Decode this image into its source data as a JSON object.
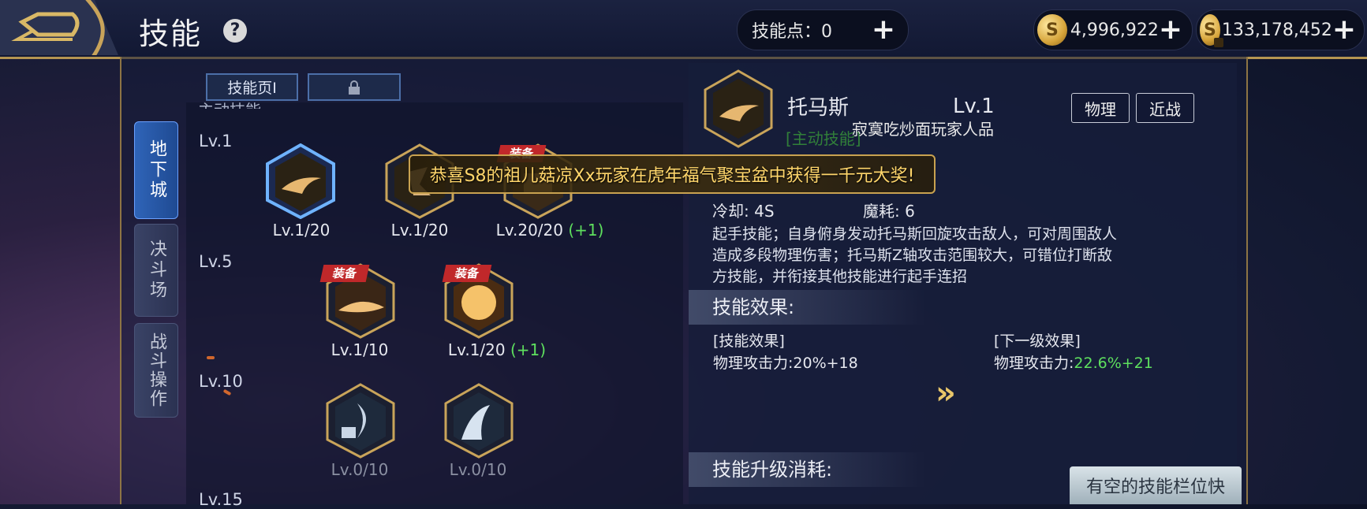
{
  "header": {
    "title": "技能",
    "skill_points_label": "技能点：0",
    "gold": "4,996,922",
    "bound_gold": "133,178,452"
  },
  "side_tabs": [
    "地下城",
    "决斗场",
    "战斗操作"
  ],
  "pages": {
    "page1": "技能页Ⅰ"
  },
  "section_title": "主动技能",
  "levels": [
    "Lv.1",
    "Lv.5",
    "Lv.10",
    "Lv.15"
  ],
  "equip_badge": "装备",
  "skills": [
    {
      "lv": "Lv.1/20",
      "bonus": ""
    },
    {
      "lv": "Lv.1/20",
      "bonus": ""
    },
    {
      "lv": "Lv.20/20",
      "bonus": "(+1)"
    },
    {
      "lv": "Lv.1/10",
      "bonus": ""
    },
    {
      "lv": "Lv.1/20",
      "bonus": "(+1)"
    },
    {
      "lv": "Lv.0/10",
      "bonus": ""
    },
    {
      "lv": "Lv.0/10",
      "bonus": ""
    }
  ],
  "detail": {
    "name": "托马斯",
    "level": "Lv.1",
    "tag_physical": "物理",
    "tag_melee": "近战",
    "type": "[主动技能]",
    "player_note": "寂寞吃炒面玩家人品",
    "cooldown": "冷却: 4S",
    "mp_cost": "魔耗: 6",
    "description": "起手技能；自身俯身发动托马斯回旋攻击敌人，可对周围敌人造成多段物理伤害；托马斯Z轴攻击范围较大，可错位打断敌方技能，并衔接其他技能进行起手连招",
    "effect_heading": "技能效果:",
    "current_label": "[技能效果]",
    "current_value": "物理攻击力:20%+18",
    "next_label": "[下一级效果]",
    "next_prefix": "物理攻击力:",
    "next_value": "22.6%+21",
    "cost_heading": "技能升级消耗:"
  },
  "banner": "恭喜S8的祖儿菇凉Xx玩家在虎年福气聚宝盆中获得一千元大奖!",
  "popup": "有空的技能栏位快"
}
